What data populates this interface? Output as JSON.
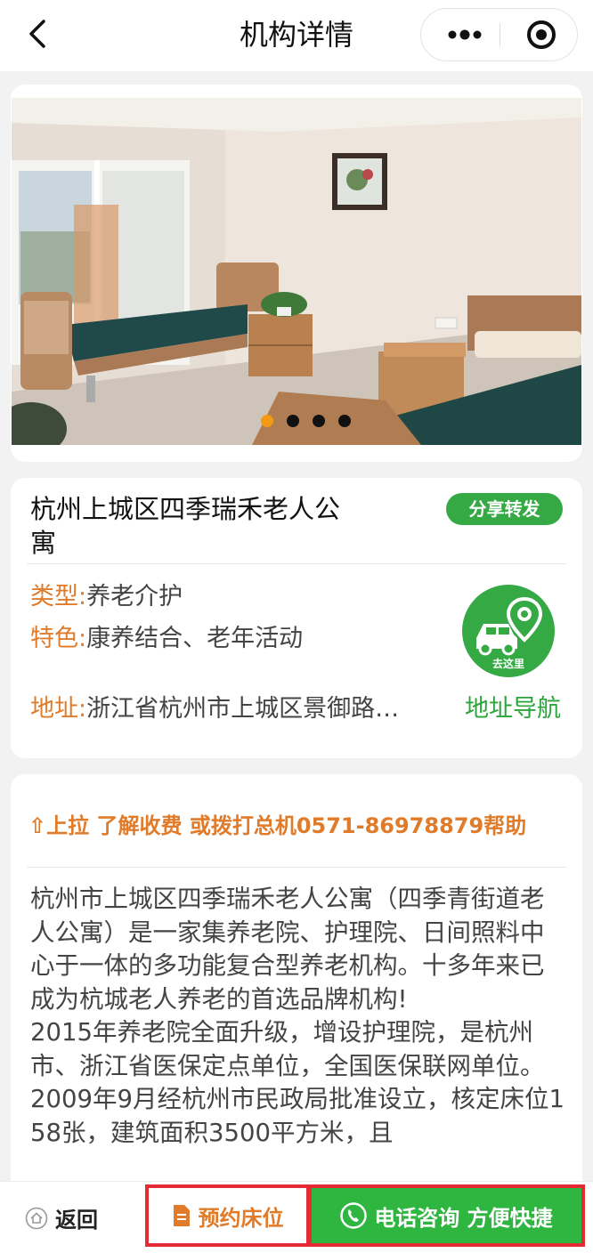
{
  "navbar": {
    "title": "机构详情",
    "back_icon": "chevron-left-icon",
    "more_icon": "more-dots-icon",
    "close_icon": "target-close-icon"
  },
  "carousel": {
    "image_alt": "房间照片",
    "slide_count": 4,
    "active_index": 0,
    "active_dot_color": "#f39a14"
  },
  "info": {
    "name": "杭州上城区四季瑞禾老人公寓",
    "share_label": "分享转发",
    "type_key": "类型:",
    "type_value": "养老介护",
    "feature_key": "特色:",
    "feature_value": "康养结合、老年活动",
    "address_key": "地址:",
    "address_value": "浙江省杭州市上城区景御路…",
    "nav_link": "地址导航",
    "goto_label": "去这里",
    "goto_icon": "car-location-icon"
  },
  "description": {
    "tip": "⇧上拉 了解收费 或拨打总机0571-86978879帮助",
    "para1": "杭州市上城区四季瑞禾老人公寓（四季青街道老人公寓）是一家集养老院、护理院、日间照料中心于一体的多功能复合型养老机构。十多年来已成为杭城老人养老的首选品牌机构!",
    "para2": "2015年养老院全面升级，增设护理院，是杭州市、浙江省医保定点单位，全国医保联网单位。",
    "para3": "2009年9月经杭州市民政局批准设立，核定床位158张，建筑面积3500平方米，且"
  },
  "bottombar": {
    "back_label": "返回",
    "book_label": "预约床位",
    "call_label": "电话咨询 方便快捷",
    "accent_green": "#2fb640",
    "highlight_red": "#e52a36"
  }
}
